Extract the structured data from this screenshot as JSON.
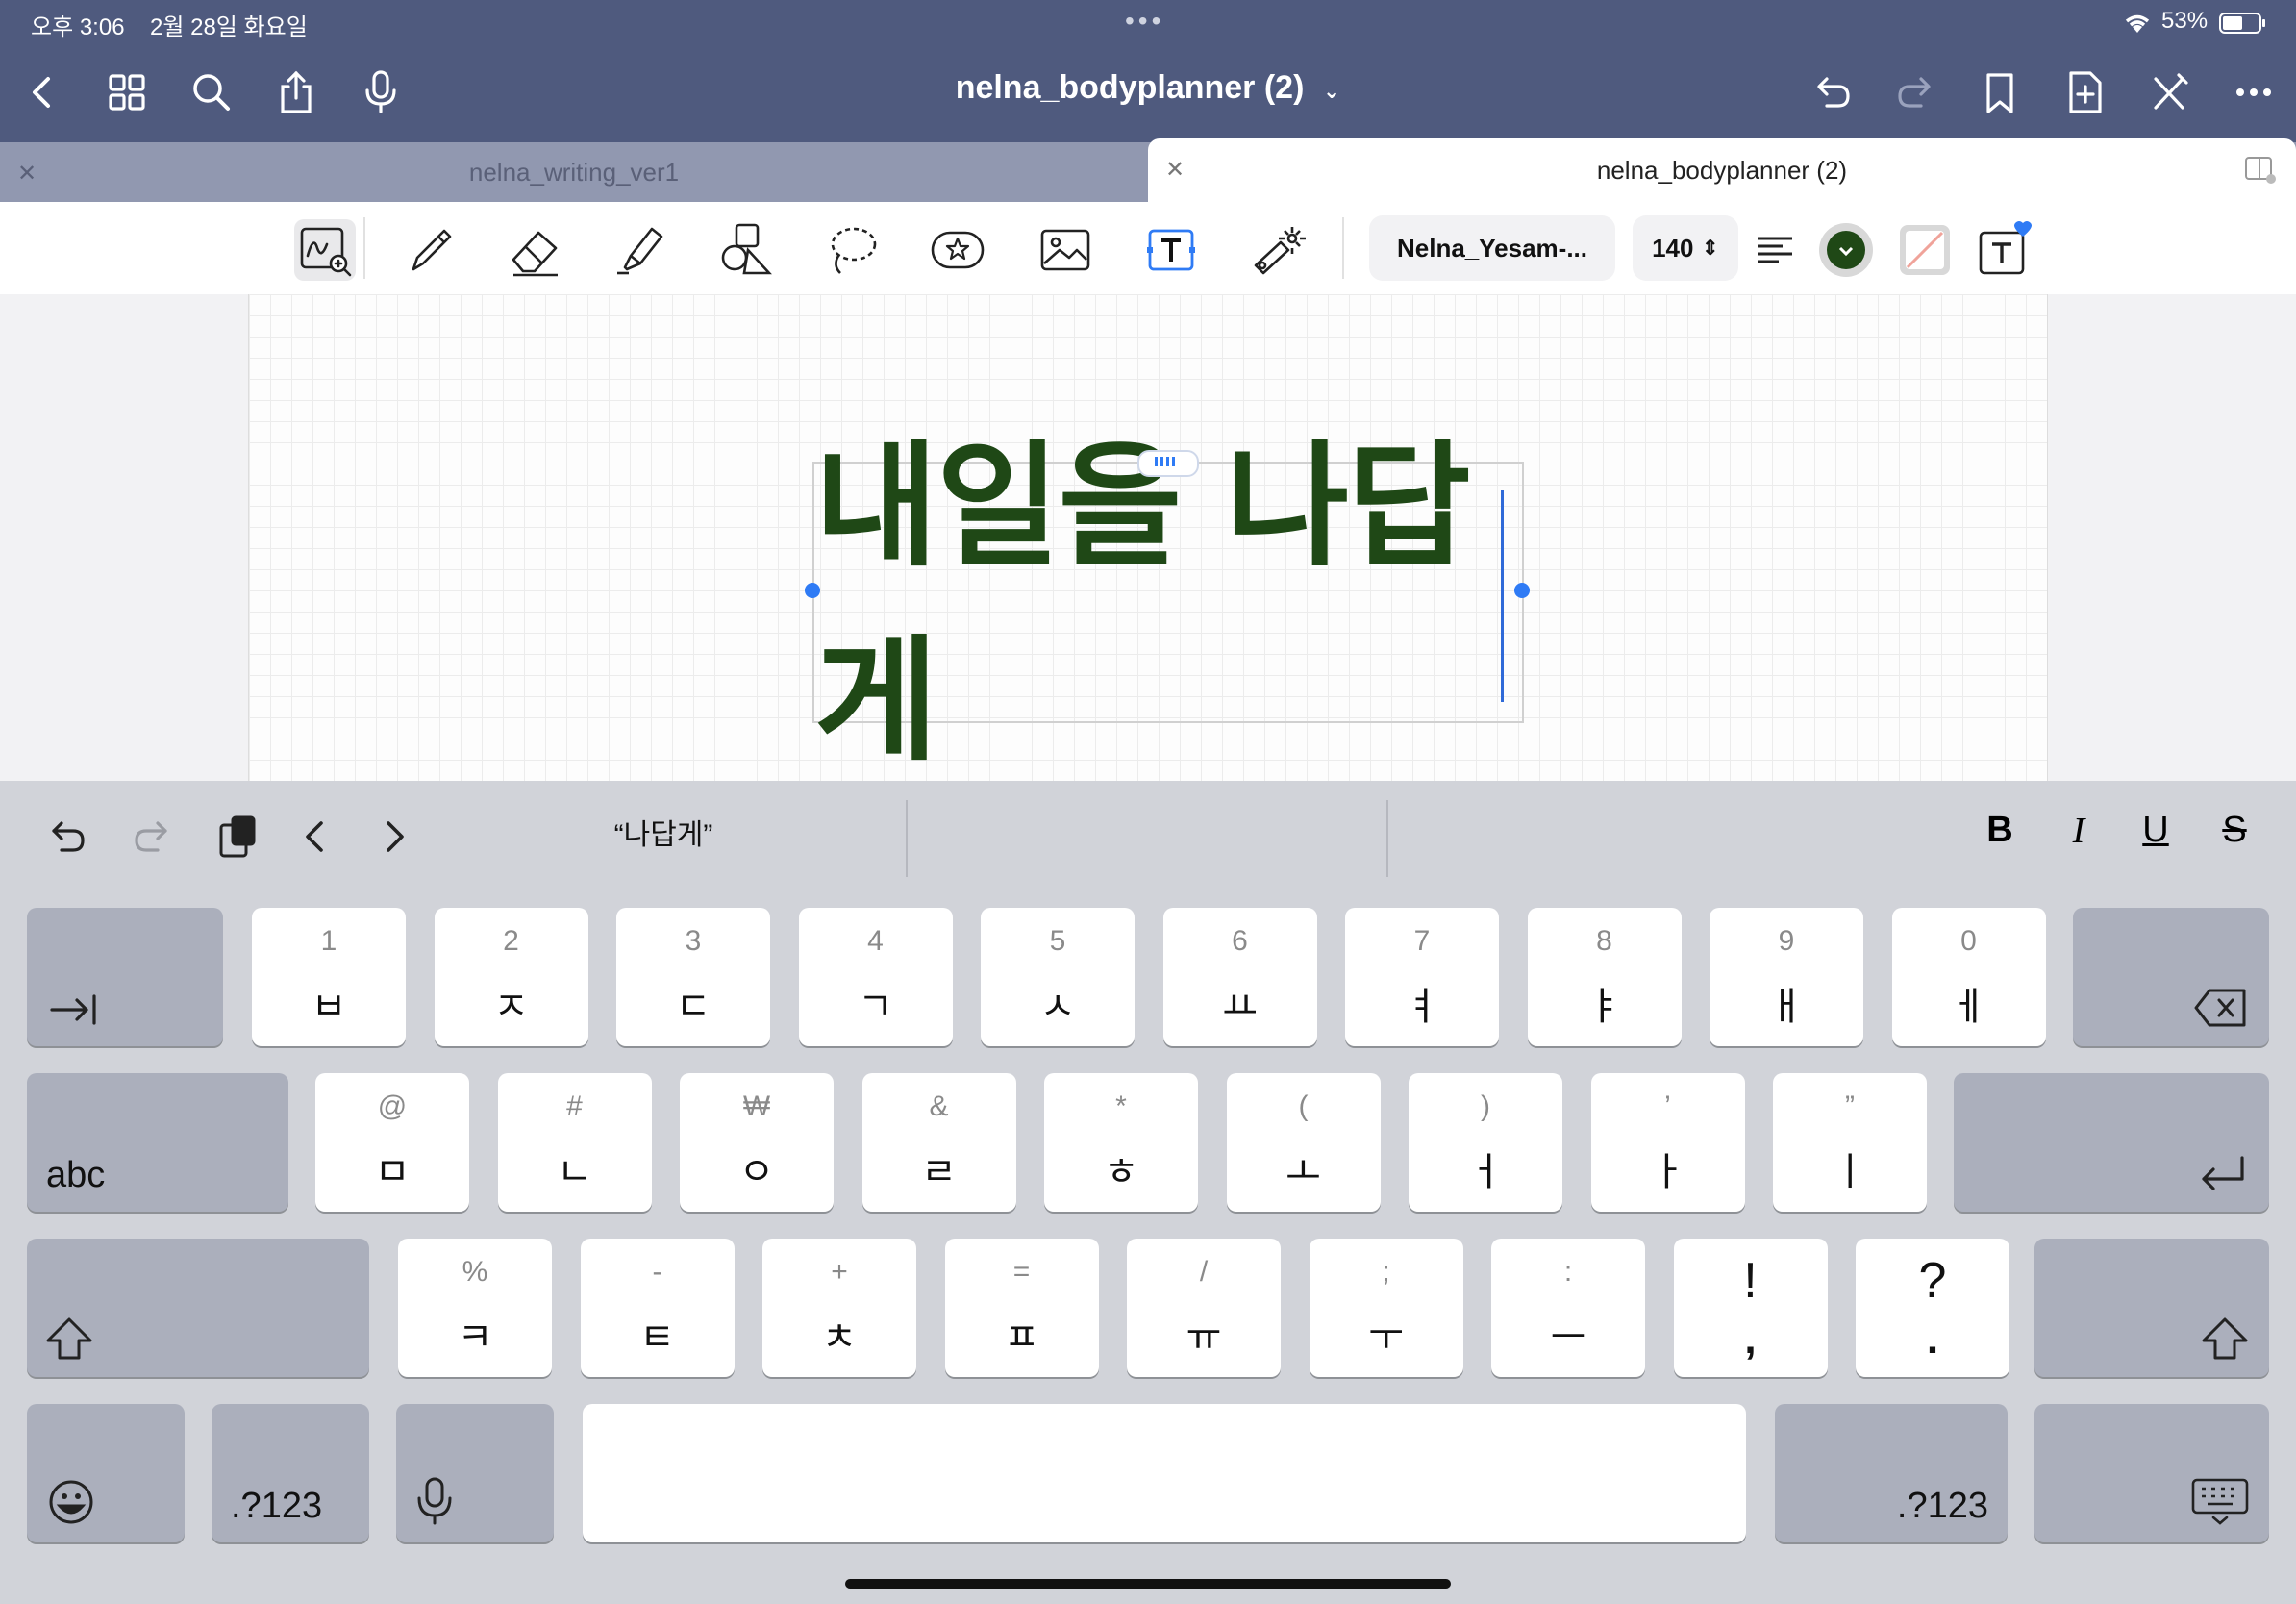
{
  "status_bar": {
    "time": "오후 3:06",
    "date": "2월 28일 화요일",
    "battery": "53%"
  },
  "document": {
    "title": "nelna_bodyplanner (2)"
  },
  "tabs": [
    {
      "label": "nelna_writing_ver1",
      "active": false
    },
    {
      "label": "nelna_bodyplanner (2)",
      "active": true
    }
  ],
  "toolbar": {
    "font_name": "Nelna_Yesam-...",
    "font_size": "140",
    "text_color": "#1f4816"
  },
  "canvas": {
    "text": "내일을 나답게"
  },
  "keyboard": {
    "suggestion": "“나답게”",
    "format_buttons": [
      "B",
      "I",
      "U",
      "S"
    ],
    "row1": [
      {
        "top": "1",
        "main": "ㅂ"
      },
      {
        "top": "2",
        "main": "ㅈ"
      },
      {
        "top": "3",
        "main": "ㄷ"
      },
      {
        "top": "4",
        "main": "ㄱ"
      },
      {
        "top": "5",
        "main": "ㅅ"
      },
      {
        "top": "6",
        "main": "ㅛ"
      },
      {
        "top": "7",
        "main": "ㅕ"
      },
      {
        "top": "8",
        "main": "ㅑ"
      },
      {
        "top": "9",
        "main": "ㅐ"
      },
      {
        "top": "0",
        "main": "ㅔ"
      }
    ],
    "row2": [
      {
        "top": "@",
        "main": "ㅁ"
      },
      {
        "top": "#",
        "main": "ㄴ"
      },
      {
        "top": "₩",
        "main": "ㅇ"
      },
      {
        "top": "&",
        "main": "ㄹ"
      },
      {
        "top": "*",
        "main": "ㅎ"
      },
      {
        "top": "(",
        "main": "ㅗ"
      },
      {
        "top": ")",
        "main": "ㅓ"
      },
      {
        "top": "’",
        "main": "ㅏ"
      },
      {
        "top": "”",
        "main": "ㅣ"
      }
    ],
    "row3": [
      {
        "top": "%",
        "main": "ㅋ"
      },
      {
        "top": "-",
        "main": "ㅌ"
      },
      {
        "top": "+",
        "main": "ㅊ"
      },
      {
        "top": "=",
        "main": "ㅍ"
      },
      {
        "top": "/",
        "main": "ㅠ"
      },
      {
        "top": ";",
        "main": "ㅜ"
      },
      {
        "top": ":",
        "main": "ㅡ"
      },
      {
        "top": "!",
        "main": ","
      },
      {
        "top": "?",
        "main": "."
      }
    ],
    "abc_label": "abc",
    "num_label": ".?123"
  }
}
